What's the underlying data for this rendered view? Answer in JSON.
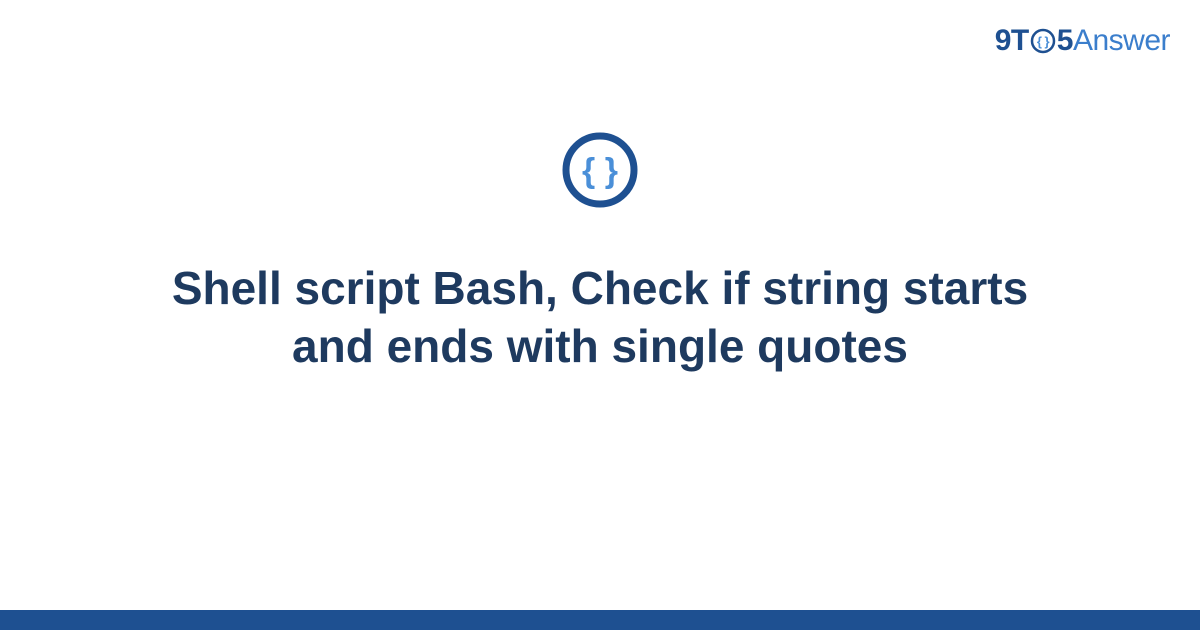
{
  "logo": {
    "part1": "9T",
    "part2": "5",
    "part3": "Answer"
  },
  "main": {
    "title": "Shell script Bash, Check if string starts and ends with single quotes"
  },
  "colors": {
    "dark_blue": "#1e5091",
    "light_blue": "#3b7ecc",
    "title_color": "#1e3a5f",
    "icon_inner": "#4a8fd8"
  }
}
